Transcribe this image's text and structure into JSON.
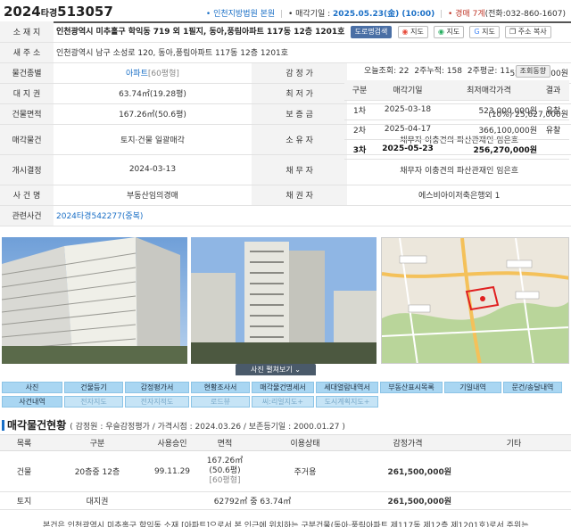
{
  "header": {
    "case_year": "2024",
    "case_type": "타경",
    "case_no": "513057",
    "court": "• 인천지방법원 본원",
    "sale_date_label": "• 매각기일 :",
    "sale_date": "2025.05.23(金) (10:00)",
    "round": "• 경매 7계",
    "phone": "(전화:032-860-1607)"
  },
  "info": {
    "location_label": "소 재 지",
    "location": "인천광역시 미추홀구 학익동 719 외 1필지, 동아,풍림아파트 117동 12층 1201호",
    "btn_road": "도로명검색",
    "btn_map1": "지도",
    "btn_map2": "지도",
    "btn_map3": "지도",
    "btn_copy": "주소 복사",
    "new_addr_label": "새 주 소",
    "new_addr": "인천광역시 남구 소성로 120, 동아,풍림아파트 117동 12층 1201호",
    "kind_label": "물건종별",
    "kind": "아파트",
    "kind_pyeong": "[60평형]",
    "appraisal_label": "감 정 가",
    "appraisal": "523,000,000원",
    "land_label": "대 지 권",
    "land": "63.74㎡(19.28평)",
    "min_label": "최 저 가",
    "min": "(49%) 256,270,000원",
    "building_label": "건물면적",
    "building": "167.26㎡(50.6평)",
    "deposit_label": "보 증 금",
    "deposit": "(10%) 25,627,000원",
    "sale_obj_label": "매각물건",
    "sale_obj": "토지·건물 일괄매각",
    "owner_label": "소 유 자",
    "owner": "채무자 이충견의 파산관재인 임은흐",
    "decision_label": "개시결정",
    "decision": "2024-03-13",
    "debtor_label": "채 무 자",
    "debtor": "채무자 이충견의 파산관재인 임은흐",
    "casename_label": "사 건 명",
    "casename": "부동산임의경매",
    "creditor_label": "채 권 자",
    "creditor": "에스비아이저축은행외 1",
    "related_label": "관련사건",
    "related": "2024타경542277(중복)"
  },
  "views": {
    "today": "오늘조회: 22",
    "two_week": "2주누적: 158",
    "avg": "2주평균: 11",
    "btn": "조회동향"
  },
  "rounds": {
    "headers": [
      "구분",
      "매각기일",
      "최저매각가격",
      "결과"
    ],
    "rows": [
      {
        "no": "1차",
        "date": "2025-03-18",
        "price": "523,000,000원",
        "result": "유찰"
      },
      {
        "no": "2차",
        "date": "2025-04-17",
        "price": "366,100,000원",
        "result": "유찰"
      },
      {
        "no": "3차",
        "date": "2025-05-23",
        "price": "256,270,000원",
        "result": ""
      }
    ]
  },
  "photo_toggle": "사진 펼쳐보기",
  "docs": {
    "row1": [
      "사진",
      "건물등기",
      "감정평가서",
      "현황조사서",
      "매각물건명세서",
      "세대열람내역서",
      "부동산표시목록",
      "기일내역",
      "문건/송달내역"
    ],
    "row2": [
      "사건내역",
      "전자지도",
      "전자지적도",
      "로드뷰",
      "씨:리얼지도+",
      "도시계획지도+"
    ]
  },
  "status_section": {
    "title": "매각물건현황",
    "sub": "( 감정원 : 우슬감정평가 / 가격시점 : 2024.03.26 / 보존등기일 : 2000.01.27 )",
    "headers": [
      "목록",
      "구분",
      "사용승인",
      "면적",
      "이용상태",
      "감정가격",
      "기타"
    ],
    "building": {
      "list": "건물",
      "kind": "20층중 12층",
      "approval": "99.11.29",
      "area1": "167.26㎡",
      "area2": "(50.6평)",
      "area3": "[60평형]",
      "use": "주거용",
      "price": "261,500,000원"
    },
    "land": {
      "list": "토지",
      "kind": "대지권",
      "area": "62792㎡ 중 63.74㎡",
      "price": "261,500,000원"
    },
    "footer": "본건은 인천광역시 미추홀구 학익동 소재 [아파트]으로서 본 인근에 위치하는 구분건물(동아·풍림아파트 제117동 제12층 제1201호)로서 주위는"
  },
  "colors": {
    "accent": "#1a6fc6",
    "doc_btn": "#a9d6f2",
    "label_bg": "#f3f3f3",
    "red": "#c0392b"
  }
}
